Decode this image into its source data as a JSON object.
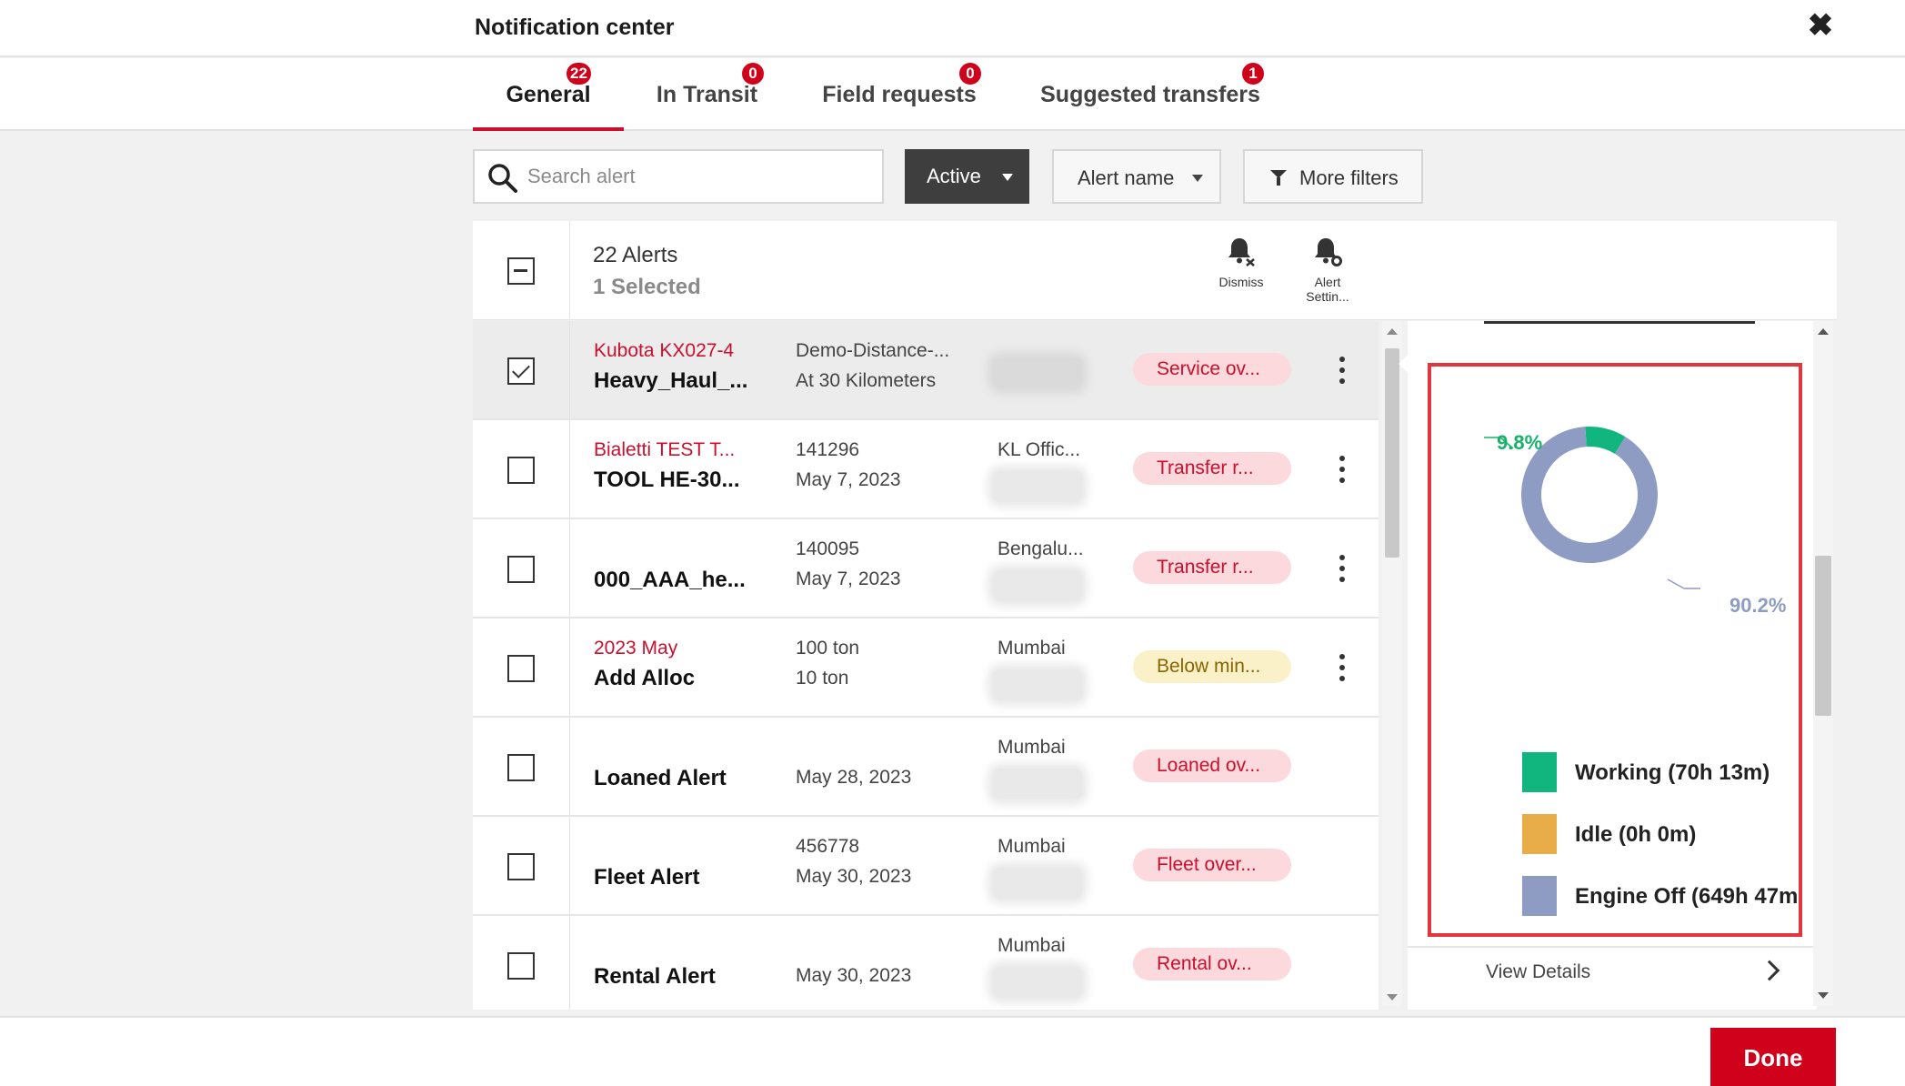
{
  "header": {
    "title": "Notification center",
    "close_icon": "close-icon"
  },
  "tabs": [
    {
      "label": "General",
      "badge": "22",
      "active": true
    },
    {
      "label": "In Transit",
      "badge": "0"
    },
    {
      "label": "Field requests",
      "badge": "0"
    },
    {
      "label": "Suggested transfers",
      "badge": "1"
    }
  ],
  "toolbar": {
    "search_placeholder": "Search alert",
    "status_label": "Active",
    "alert_name_label": "Alert name",
    "more_filters_label": "More filters"
  },
  "list_header": {
    "alerts_count": "22 Alerts",
    "selected_count": "1 Selected",
    "dismiss_label": "Dismiss",
    "alert_settings_label_1": "Alert",
    "alert_settings_label_2": "Settin..."
  },
  "rows": [
    {
      "line1": "Kubota KX027-4",
      "line2": "Heavy_Haul_...",
      "col3a": "Demo-Distance-...",
      "col3b": "At 30 Kilometers",
      "col4": "",
      "status": "Service ov...",
      "status_color": "red",
      "selected": true
    },
    {
      "line1": "Bialetti TEST T...",
      "line2": "TOOL HE-30...",
      "col3a": "141296",
      "col3b": "May 7, 2023",
      "col4": "KL Offic...",
      "status": "Transfer r...",
      "status_color": "red"
    },
    {
      "line1": "",
      "line2": "000_AAA_he...",
      "col3a": "140095",
      "col3b": "May 7, 2023",
      "col4": "Bengalu...",
      "status": "Transfer r...",
      "status_color": "red"
    },
    {
      "line1": "2023 May",
      "line2": "Add Alloc",
      "col3a": "100 ton",
      "col3b": "10 ton",
      "col4": "Mumbai",
      "status": "Below min...",
      "status_color": "yellow"
    },
    {
      "line1": "",
      "line2": "Loaned Alert",
      "col3a": "",
      "col3b": "May 28, 2023",
      "col4": "Mumbai",
      "status": "Loaned ov...",
      "status_color": "red"
    },
    {
      "line1": "",
      "line2": "Fleet Alert",
      "col3a": "456778",
      "col3b": "May 30, 2023",
      "col4": "Mumbai",
      "status": "Fleet over...",
      "status_color": "red"
    },
    {
      "line1": "",
      "line2": "Rental Alert",
      "col3a": "",
      "col3b": "May 30, 2023",
      "col4": "Mumbai",
      "status": "Rental ov...",
      "status_color": "red"
    }
  ],
  "detail_panel": {
    "donut_labels": {
      "working_pct": "9.8%",
      "engine_off_pct": "90.2%"
    },
    "legend": [
      {
        "label": "Working (70h 13m)",
        "color": "#11b67e"
      },
      {
        "label": "Idle (0h 0m)",
        "color": "#e8ad48"
      },
      {
        "label": "Engine Off (649h 47m",
        "color": "#8e9cc4"
      }
    ],
    "view_details_label": "View Details"
  },
  "chart_data": {
    "type": "pie",
    "categories": [
      "Working",
      "Idle",
      "Engine Off"
    ],
    "values": [
      9.8,
      0,
      90.2
    ],
    "colors": [
      "#11b67e",
      "#e8ad48",
      "#8e9cc4"
    ],
    "title": "",
    "legend": "bottom"
  },
  "footer": {
    "done_label": "Done"
  }
}
